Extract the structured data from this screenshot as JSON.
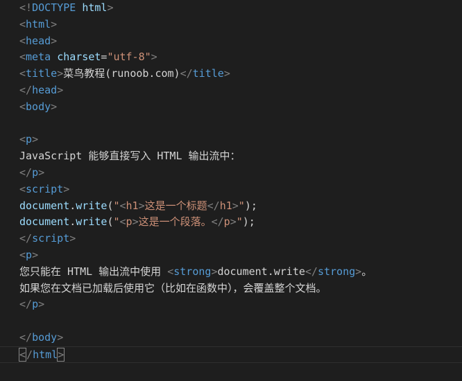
{
  "editor": {
    "lines": [
      [
        {
          "c": "t-punct",
          "t": "<!"
        },
        {
          "c": "t-tag",
          "t": "DOCTYPE"
        },
        {
          "c": "t-plain",
          "t": " "
        },
        {
          "c": "t-attr",
          "t": "html"
        },
        {
          "c": "t-punct",
          "t": ">"
        }
      ],
      [
        {
          "c": "t-punct",
          "t": "<"
        },
        {
          "c": "t-tag",
          "t": "html"
        },
        {
          "c": "t-punct",
          "t": ">"
        }
      ],
      [
        {
          "c": "t-punct",
          "t": "<"
        },
        {
          "c": "t-tag",
          "t": "head"
        },
        {
          "c": "t-punct",
          "t": ">"
        }
      ],
      [
        {
          "c": "t-punct",
          "t": "<"
        },
        {
          "c": "t-tag",
          "t": "meta"
        },
        {
          "c": "t-plain",
          "t": " "
        },
        {
          "c": "t-attr",
          "t": "charset"
        },
        {
          "c": "t-plain",
          "t": "="
        },
        {
          "c": "t-str",
          "t": "\"utf-8\""
        },
        {
          "c": "t-punct",
          "t": ">"
        }
      ],
      [
        {
          "c": "t-punct",
          "t": "<"
        },
        {
          "c": "t-tag",
          "t": "title"
        },
        {
          "c": "t-punct",
          "t": ">"
        },
        {
          "c": "t-text",
          "t": "菜鸟教程(runoob.com)"
        },
        {
          "c": "t-punct",
          "t": "</"
        },
        {
          "c": "t-tag",
          "t": "title"
        },
        {
          "c": "t-punct",
          "t": ">"
        }
      ],
      [
        {
          "c": "t-punct",
          "t": "</"
        },
        {
          "c": "t-tag",
          "t": "head"
        },
        {
          "c": "t-punct",
          "t": ">"
        }
      ],
      [
        {
          "c": "t-punct",
          "t": "<"
        },
        {
          "c": "t-tag",
          "t": "body"
        },
        {
          "c": "t-punct",
          "t": ">"
        }
      ],
      [],
      [
        {
          "c": "t-punct",
          "t": "<"
        },
        {
          "c": "t-tag",
          "t": "p"
        },
        {
          "c": "t-punct",
          "t": ">"
        }
      ],
      [
        {
          "c": "t-text",
          "t": "JavaScript 能够直接写入 HTML 输出流中："
        }
      ],
      [
        {
          "c": "t-punct",
          "t": "</"
        },
        {
          "c": "t-tag",
          "t": "p"
        },
        {
          "c": "t-punct",
          "t": ">"
        }
      ],
      [
        {
          "c": "t-punct",
          "t": "<"
        },
        {
          "c": "t-tag",
          "t": "script"
        },
        {
          "c": "t-punct",
          "t": ">"
        }
      ],
      [
        {
          "c": "t-js",
          "t": "document"
        },
        {
          "c": "t-plain",
          "t": "."
        },
        {
          "c": "t-js",
          "t": "write"
        },
        {
          "c": "t-plain",
          "t": "("
        },
        {
          "c": "t-str",
          "t": "\""
        },
        {
          "c": "t-punct",
          "t": "<"
        },
        {
          "c": "t-str",
          "t": "h1"
        },
        {
          "c": "t-punct",
          "t": ">"
        },
        {
          "c": "t-str",
          "t": "这是一个标题"
        },
        {
          "c": "t-punct",
          "t": "</"
        },
        {
          "c": "t-str",
          "t": "h1"
        },
        {
          "c": "t-punct",
          "t": ">"
        },
        {
          "c": "t-str",
          "t": "\""
        },
        {
          "c": "t-plain",
          "t": ");"
        }
      ],
      [
        {
          "c": "t-js",
          "t": "document"
        },
        {
          "c": "t-plain",
          "t": "."
        },
        {
          "c": "t-js",
          "t": "write"
        },
        {
          "c": "t-plain",
          "t": "("
        },
        {
          "c": "t-str",
          "t": "\""
        },
        {
          "c": "t-punct",
          "t": "<"
        },
        {
          "c": "t-str",
          "t": "p"
        },
        {
          "c": "t-punct",
          "t": ">"
        },
        {
          "c": "t-str",
          "t": "这是一个段落。"
        },
        {
          "c": "t-punct",
          "t": "</"
        },
        {
          "c": "t-str",
          "t": "p"
        },
        {
          "c": "t-punct",
          "t": ">"
        },
        {
          "c": "t-str",
          "t": "\""
        },
        {
          "c": "t-plain",
          "t": ");"
        }
      ],
      [
        {
          "c": "t-punct",
          "t": "</"
        },
        {
          "c": "t-tag",
          "t": "script"
        },
        {
          "c": "t-punct",
          "t": ">"
        }
      ],
      [
        {
          "c": "t-punct",
          "t": "<"
        },
        {
          "c": "t-tag",
          "t": "p"
        },
        {
          "c": "t-punct",
          "t": ">"
        }
      ],
      [
        {
          "c": "t-text",
          "t": "您只能在 HTML 输出流中使用 "
        },
        {
          "c": "t-punct",
          "t": "<"
        },
        {
          "c": "t-tag",
          "t": "strong"
        },
        {
          "c": "t-punct",
          "t": ">"
        },
        {
          "c": "t-text",
          "t": "document.write"
        },
        {
          "c": "t-punct",
          "t": "</"
        },
        {
          "c": "t-tag",
          "t": "strong"
        },
        {
          "c": "t-punct",
          "t": ">"
        },
        {
          "c": "t-text",
          "t": "。"
        }
      ],
      [
        {
          "c": "t-text",
          "t": "如果您在文档已加载后使用它（比如在函数中），会覆盖整个文档。"
        }
      ],
      [
        {
          "c": "t-punct",
          "t": "</"
        },
        {
          "c": "t-tag",
          "t": "p"
        },
        {
          "c": "t-punct",
          "t": ">"
        }
      ],
      [],
      [
        {
          "c": "t-punct",
          "t": "</"
        },
        {
          "c": "t-tag",
          "t": "body"
        },
        {
          "c": "t-punct",
          "t": ">"
        }
      ],
      [
        {
          "c": "t-punct",
          "t": "<",
          "m": true
        },
        {
          "c": "t-punct",
          "t": "/"
        },
        {
          "c": "t-tag",
          "t": "html"
        },
        {
          "c": "t-punct",
          "t": ">",
          "m": true
        }
      ]
    ],
    "cursor_line": 21,
    "colors": {
      "background": "#1e1e1e",
      "tag": "#569cd6",
      "punctuation": "#808080",
      "attribute": "#9cdcfe",
      "string": "#ce9178",
      "text": "#d4d4d4"
    }
  }
}
